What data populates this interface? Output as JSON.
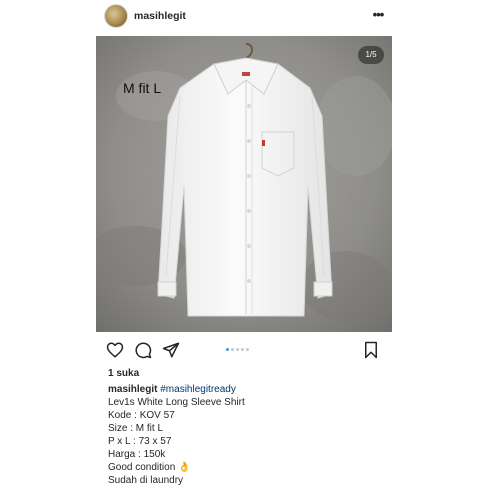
{
  "header": {
    "username": "masihlegit",
    "more_icon": "more-horizontal-icon",
    "more_glyph": "•••"
  },
  "photo": {
    "overlay_text": "M fit L",
    "counter": "1/5",
    "current_slide": 1,
    "total_slides": 5,
    "background_color": "#8e8d89",
    "subject": "white long sleeve shirt on hanger"
  },
  "actions": {
    "like_icon": "heart-icon",
    "comment_icon": "comment-icon",
    "share_icon": "send-icon",
    "save_icon": "bookmark-icon",
    "active_dot_color": "#3897f0"
  },
  "likes": "1 suka",
  "caption": {
    "username": "masihlegit",
    "hashtag": "#masihlegitready",
    "lines": [
      "Lev1s White Long Sleeve Shirt",
      "Kode : KOV 57",
      "Size : M fit L",
      "P x L : 73 x 57",
      "Harga : 150k",
      "Good condition 👌",
      "Sudah di laundry"
    ]
  }
}
